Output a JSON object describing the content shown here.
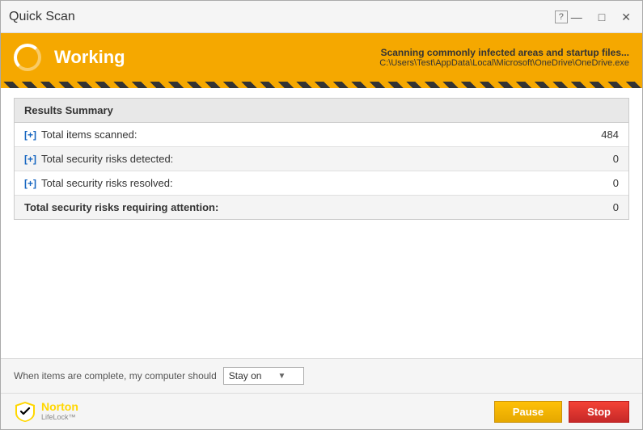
{
  "titleBar": {
    "title": "Quick Scan",
    "helpLabel": "?",
    "minimizeBtn": "—",
    "maximizeBtn": "□",
    "closeBtn": "✕"
  },
  "statusBar": {
    "workingLabel": "Working",
    "scanningLabel": "Scanning commonly infected areas and startup files...",
    "filePath": "C:\\Users\\Test\\AppData\\Local\\Microsoft\\OneDrive\\OneDrive.exe"
  },
  "resultsSummary": {
    "header": "Results Summary",
    "rows": [
      {
        "expandable": true,
        "label": "Total items scanned:",
        "value": "484"
      },
      {
        "expandable": true,
        "label": "Total security risks detected:",
        "value": "0"
      },
      {
        "expandable": true,
        "label": "Total security risks resolved:",
        "value": "0"
      },
      {
        "expandable": false,
        "label": "Total security risks requiring attention:",
        "value": "0"
      }
    ],
    "expandText": "[+]"
  },
  "bottomSection": {
    "whenCompleteLabel": "When items are complete, my computer should",
    "dropdownValue": "Stay on",
    "dropdownArrow": "▼"
  },
  "footer": {
    "nortonBrand": "Norton",
    "nortonSub": "LifeLock™",
    "pauseBtn": "Pause",
    "stopBtn": "Stop"
  }
}
